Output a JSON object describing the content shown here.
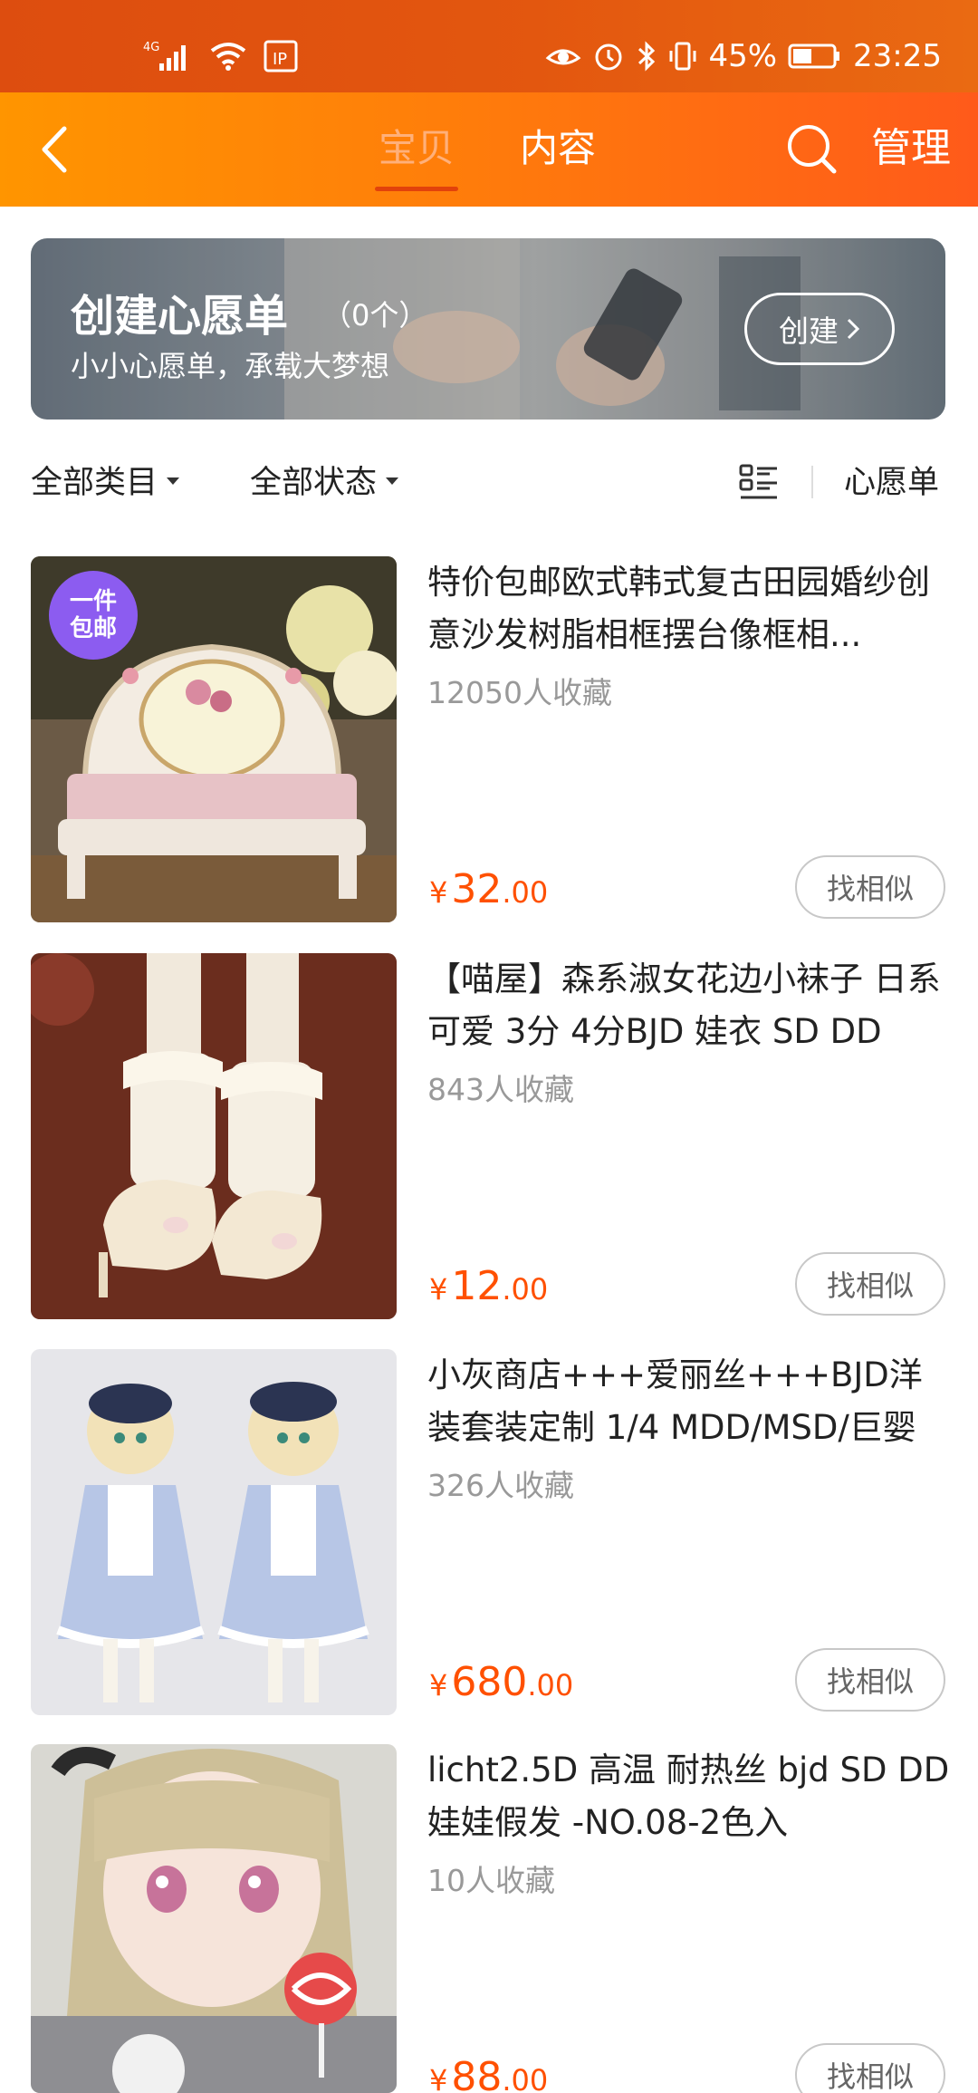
{
  "status_bar": {
    "network": "4G",
    "battery_percent": "45%",
    "time": "23:25"
  },
  "nav": {
    "tabs": [
      {
        "label": "宝贝",
        "active": true
      },
      {
        "label": "内容",
        "active": false
      }
    ],
    "manage_label": "管理"
  },
  "banner": {
    "title": "创建心愿单",
    "count": "（0个）",
    "subtitle": "小小心愿单，承载大梦想",
    "button_label": "创建"
  },
  "filters": {
    "category": "全部类目",
    "status": "全部状态",
    "wishlist": "心愿单"
  },
  "products": [
    {
      "title": "特价包邮欧式韩式复古田园婚纱创意沙发树脂相框摆台像框相...",
      "favorites": "12050人收藏",
      "price_int": "32",
      "price_dec": ".00",
      "badge": [
        "一件",
        "包邮"
      ],
      "similar_label": "找相似"
    },
    {
      "title": "【喵屋】森系淑女花边小袜子 日系 可爱 3分 4分BJD 娃衣 SD DD",
      "favorites": "843人收藏",
      "price_int": "12",
      "price_dec": ".00",
      "similar_label": "找相似"
    },
    {
      "title": "小灰商店+++爱丽丝+++BJD洋装套装定制 1/4 MDD/MSD/巨婴",
      "favorites": "326人收藏",
      "price_int": "680",
      "price_dec": ".00",
      "similar_label": "找相似"
    },
    {
      "title": "licht2.5D 高温 耐热丝 bjd SD DD 娃娃假发 -NO.08-2色入",
      "favorites": "10人收藏",
      "price_int": "88",
      "price_dec": ".00",
      "similar_label": "找相似"
    }
  ],
  "currency_symbol": "¥",
  "colors": {
    "status_bar": "#e3570f",
    "nav_start": "#ff9500",
    "nav_end": "#ff5a1a",
    "price": "#ff5000",
    "badge": "#8c5cf0"
  }
}
